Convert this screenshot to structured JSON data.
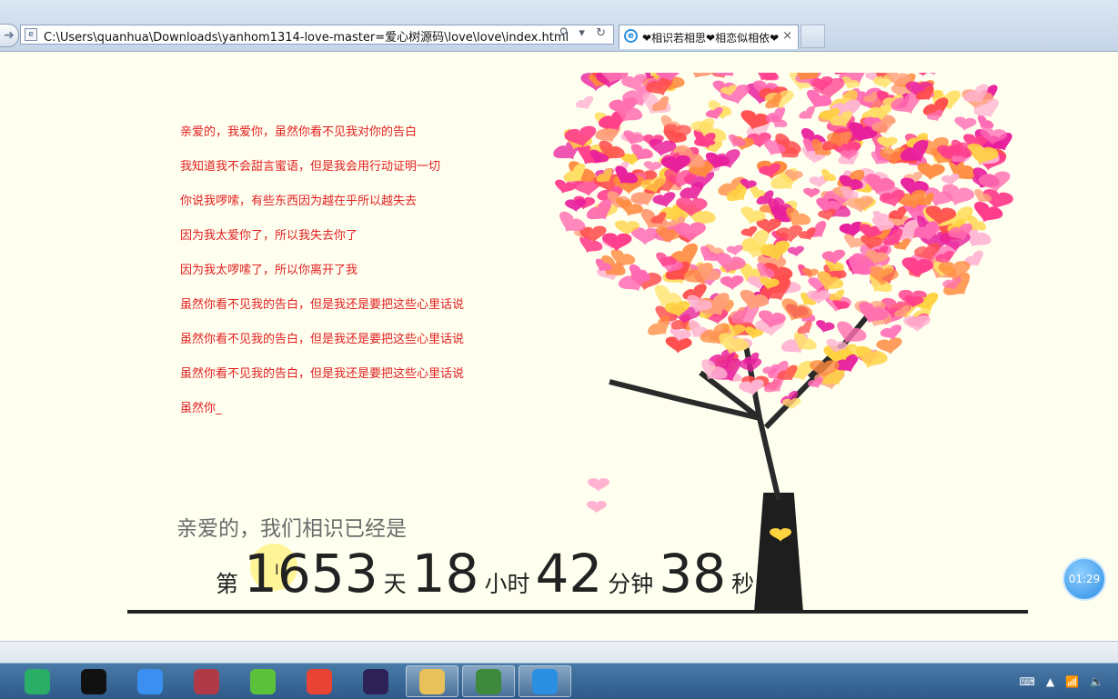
{
  "browser": {
    "address": "C:\\Users\\quanhua\\Downloads\\yanhom1314-love-master=爱心树源码\\love\\love\\index.html",
    "tab_title": "❤相识若相思❤相恋似相依❤",
    "tab_close": "×",
    "address_tools": "⚲ ▾ ↻"
  },
  "poem": {
    "lines": [
      "亲爱的，我爱你，虽然你看不见我对你的告白",
      "我知道我不会甜言蜜语，但是我会用行动证明一切",
      "你说我啰嗦，有些东西因为越在乎所以越失去",
      "因为我太爱你了，所以我失去你了",
      "因为我太啰嗦了，所以你离开了我",
      "虽然你看不见我的告白，但是我还是要把这些心里话说",
      "虽然你看不见我的告白，但是我还是要把这些心里话说",
      "虽然你看不见我的告白，但是我还是要把这些心里话说",
      "虽然你_"
    ]
  },
  "counter": {
    "heading": "亲爱的，我们相识已经是",
    "prefix": "第",
    "days": "1653",
    "days_unit": "天",
    "hours": "18",
    "hours_unit": "小时",
    "minutes": "42",
    "minutes_unit": "分钟",
    "seconds": "38",
    "seconds_unit": "秒"
  },
  "overlay_timer": "01:29",
  "tree_colors": [
    "#ff3d8b",
    "#ff6fb0",
    "#ffb3d1",
    "#ff8a3d",
    "#ffd23f",
    "#ff4d4d",
    "#e81e9c",
    "#ffa07a",
    "#ff69b4",
    "#ffe066"
  ],
  "taskbar": {
    "apps": [
      {
        "name": "wechat-icon",
        "color": "#2aae67"
      },
      {
        "name": "qq-icon",
        "color": "#111111"
      },
      {
        "name": "baidu-netdisk-icon",
        "color": "#3b8ff0"
      },
      {
        "name": "database-icon",
        "color": "#b03a48"
      },
      {
        "name": "leaf-app-icon",
        "color": "#5cc13a"
      },
      {
        "name": "chrome-icon",
        "color": "#e84335"
      },
      {
        "name": "eclipse-icon",
        "color": "#2c2255"
      },
      {
        "name": "file-explorer-icon",
        "color": "#e8c15a"
      },
      {
        "name": "editor-icon",
        "color": "#3d8a3d"
      },
      {
        "name": "internet-explorer-icon",
        "color": "#2a8fe0"
      }
    ],
    "tray": [
      "⌨",
      "▲",
      "📶",
      "🔈"
    ]
  }
}
